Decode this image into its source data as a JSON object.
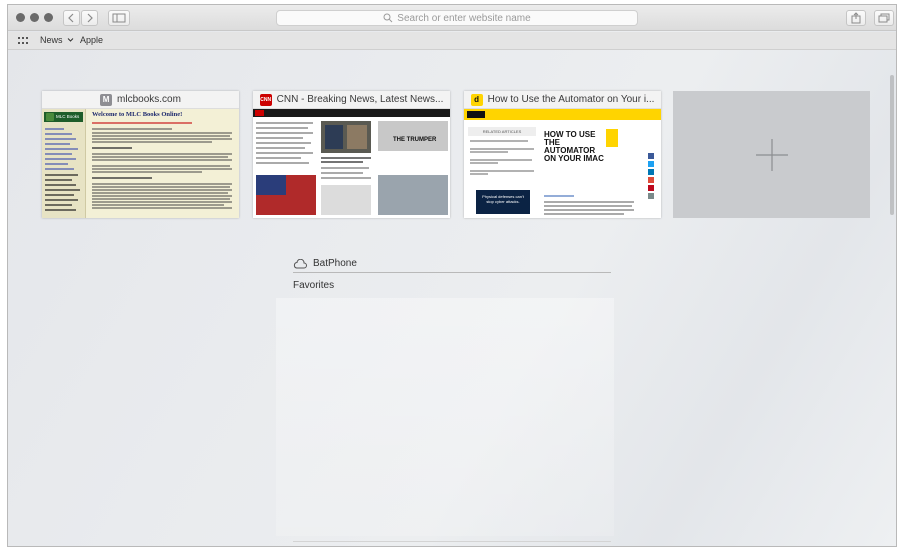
{
  "toolbar": {
    "address_placeholder": "Search or enter website name"
  },
  "bookmarks": {
    "items": [
      {
        "label": "News",
        "has_dropdown": true
      },
      {
        "label": "Apple",
        "has_dropdown": false
      }
    ]
  },
  "top_sites": [
    {
      "title": "mlcbooks.com",
      "favicon_letter": "M",
      "favicon_bg": "#8e8e93",
      "preview": {
        "header": "Welcome to MLC Books Online!",
        "sidebar_logo": "MLC Books"
      }
    },
    {
      "title": "CNN - Breaking News, Latest News...",
      "favicon_letter": "CNN",
      "favicon_bg": "#cc0000"
    },
    {
      "title": "How to Use the Automator on Your i...",
      "favicon_letter": "d",
      "favicon_bg": "#ffd400",
      "preview": {
        "headline": "HOW TO USE THE AUTOMATOR ON YOUR IMAC",
        "sidebar_header": "RELATED ARTICLES",
        "ad_text": "Physical defenses can't stop cyber attacks."
      }
    }
  ],
  "icloud": {
    "device_name": "BatPhone",
    "favorites_label": "Favorites"
  },
  "colors": {
    "accent": "#e4e6ea",
    "cnn_red": "#cc0000",
    "dummies_yellow": "#ffd400"
  }
}
